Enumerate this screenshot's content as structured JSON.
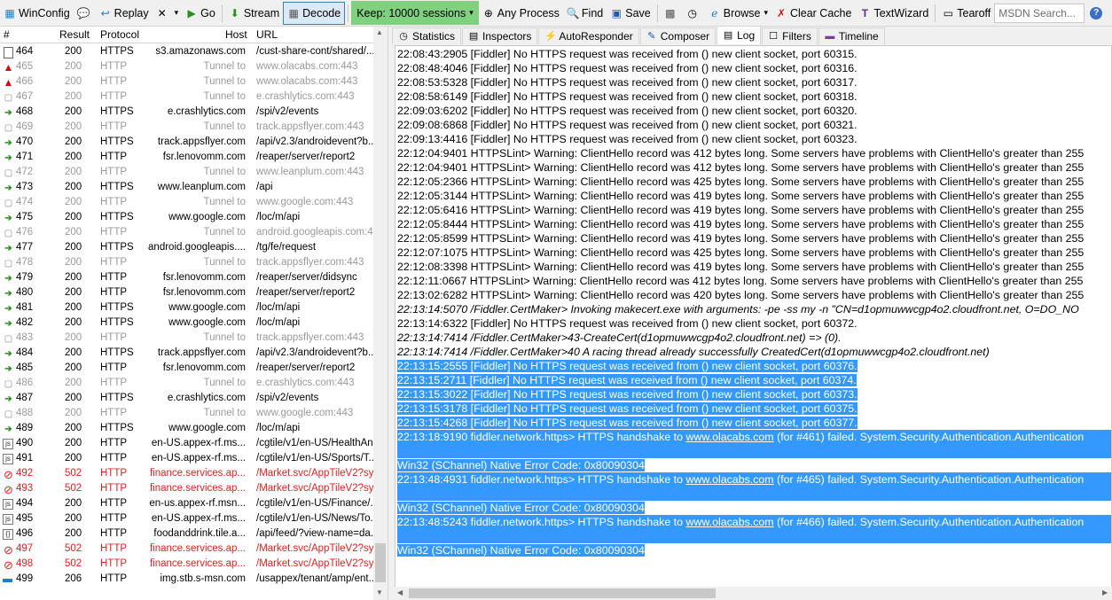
{
  "toolbar": {
    "winconfig": "WinConfig",
    "replay": "Replay",
    "go": "Go",
    "stream": "Stream",
    "decode": "Decode",
    "keep": "Keep: 10000 sessions",
    "any_process": "Any Process",
    "find": "Find",
    "save": "Save",
    "browse": "Browse",
    "clear_cache": "Clear Cache",
    "textwizard": "TextWizard",
    "tearoff": "Tearoff",
    "search_placeholder": "MSDN Search..."
  },
  "sessions": {
    "columns": {
      "num": "#",
      "result": "Result",
      "protocol": "Protocol",
      "host": "Host",
      "url": "URL"
    },
    "rows": [
      {
        "icon": "page-icon",
        "num": "464",
        "result": "200",
        "protocol": "HTTPS",
        "host": "s3.amazonaws.com",
        "url": "/cust-share-cont/shared/...",
        "kind": "normal"
      },
      {
        "icon": "warning-icon",
        "num": "465",
        "result": "200",
        "protocol": "HTTP",
        "host": "Tunnel to",
        "url": "www.olacabs.com:443",
        "kind": "tunnel"
      },
      {
        "icon": "warning-icon",
        "num": "466",
        "result": "200",
        "protocol": "HTTP",
        "host": "Tunnel to",
        "url": "www.olacabs.com:443",
        "kind": "tunnel"
      },
      {
        "icon": "lock-icon",
        "num": "467",
        "result": "200",
        "protocol": "HTTP",
        "host": "Tunnel to",
        "url": "e.crashlytics.com:443",
        "kind": "tunnel"
      },
      {
        "icon": "arrow-icon",
        "num": "468",
        "result": "200",
        "protocol": "HTTPS",
        "host": "e.crashlytics.com",
        "url": "/spi/v2/events",
        "kind": "normal"
      },
      {
        "icon": "lock-icon",
        "num": "469",
        "result": "200",
        "protocol": "HTTP",
        "host": "Tunnel to",
        "url": "track.appsflyer.com:443",
        "kind": "tunnel"
      },
      {
        "icon": "arrow-icon",
        "num": "470",
        "result": "200",
        "protocol": "HTTPS",
        "host": "track.appsflyer.com",
        "url": "/api/v2.3/androidevent?b...",
        "kind": "normal"
      },
      {
        "icon": "arrow-icon",
        "num": "471",
        "result": "200",
        "protocol": "HTTP",
        "host": "fsr.lenovomm.com",
        "url": "/reaper/server/report2",
        "kind": "normal"
      },
      {
        "icon": "lock-icon",
        "num": "472",
        "result": "200",
        "protocol": "HTTP",
        "host": "Tunnel to",
        "url": "www.leanplum.com:443",
        "kind": "tunnel"
      },
      {
        "icon": "arrow-icon",
        "num": "473",
        "result": "200",
        "protocol": "HTTPS",
        "host": "www.leanplum.com",
        "url": "/api",
        "kind": "normal"
      },
      {
        "icon": "lock-icon",
        "num": "474",
        "result": "200",
        "protocol": "HTTP",
        "host": "Tunnel to",
        "url": "www.google.com:443",
        "kind": "tunnel"
      },
      {
        "icon": "arrow-icon",
        "num": "475",
        "result": "200",
        "protocol": "HTTPS",
        "host": "www.google.com",
        "url": "/loc/m/api",
        "kind": "normal"
      },
      {
        "icon": "lock-icon",
        "num": "476",
        "result": "200",
        "protocol": "HTTP",
        "host": "Tunnel to",
        "url": "android.googleapis.com:443",
        "kind": "tunnel"
      },
      {
        "icon": "arrow-icon",
        "num": "477",
        "result": "200",
        "protocol": "HTTPS",
        "host": "android.googleapis....",
        "url": "/tg/fe/request",
        "kind": "normal"
      },
      {
        "icon": "lock-icon",
        "num": "478",
        "result": "200",
        "protocol": "HTTP",
        "host": "Tunnel to",
        "url": "track.appsflyer.com:443",
        "kind": "tunnel"
      },
      {
        "icon": "arrow-icon",
        "num": "479",
        "result": "200",
        "protocol": "HTTP",
        "host": "fsr.lenovomm.com",
        "url": "/reaper/server/didsync",
        "kind": "normal"
      },
      {
        "icon": "arrow-icon",
        "num": "480",
        "result": "200",
        "protocol": "HTTP",
        "host": "fsr.lenovomm.com",
        "url": "/reaper/server/report2",
        "kind": "normal"
      },
      {
        "icon": "arrow-icon",
        "num": "481",
        "result": "200",
        "protocol": "HTTPS",
        "host": "www.google.com",
        "url": "/loc/m/api",
        "kind": "normal"
      },
      {
        "icon": "arrow-icon",
        "num": "482",
        "result": "200",
        "protocol": "HTTPS",
        "host": "www.google.com",
        "url": "/loc/m/api",
        "kind": "normal"
      },
      {
        "icon": "lock-icon",
        "num": "483",
        "result": "200",
        "protocol": "HTTP",
        "host": "Tunnel to",
        "url": "track.appsflyer.com:443",
        "kind": "tunnel"
      },
      {
        "icon": "arrow-icon",
        "num": "484",
        "result": "200",
        "protocol": "HTTPS",
        "host": "track.appsflyer.com",
        "url": "/api/v2.3/androidevent?b...",
        "kind": "normal"
      },
      {
        "icon": "arrow-icon",
        "num": "485",
        "result": "200",
        "protocol": "HTTP",
        "host": "fsr.lenovomm.com",
        "url": "/reaper/server/report2",
        "kind": "normal"
      },
      {
        "icon": "lock-icon",
        "num": "486",
        "result": "200",
        "protocol": "HTTP",
        "host": "Tunnel to",
        "url": "e.crashlytics.com:443",
        "kind": "tunnel"
      },
      {
        "icon": "arrow-icon",
        "num": "487",
        "result": "200",
        "protocol": "HTTPS",
        "host": "e.crashlytics.com",
        "url": "/spi/v2/events",
        "kind": "normal"
      },
      {
        "icon": "lock-icon",
        "num": "488",
        "result": "200",
        "protocol": "HTTP",
        "host": "Tunnel to",
        "url": "www.google.com:443",
        "kind": "tunnel"
      },
      {
        "icon": "arrow-icon",
        "num": "489",
        "result": "200",
        "protocol": "HTTPS",
        "host": "www.google.com",
        "url": "/loc/m/api",
        "kind": "normal"
      },
      {
        "icon": "script-icon",
        "num": "490",
        "result": "200",
        "protocol": "HTTP",
        "host": "en-US.appex-rf.ms...",
        "url": "/cgtile/v1/en-US/HealthAn...",
        "kind": "normal"
      },
      {
        "icon": "script-icon",
        "num": "491",
        "result": "200",
        "protocol": "HTTP",
        "host": "en-US.appex-rf.ms...",
        "url": "/cgtile/v1/en-US/Sports/T...",
        "kind": "normal"
      },
      {
        "icon": "blocked-icon",
        "num": "492",
        "result": "502",
        "protocol": "HTTP",
        "host": "finance.services.ap...",
        "url": "/Market.svc/AppTileV2?sy...",
        "kind": "err"
      },
      {
        "icon": "blocked-icon",
        "num": "493",
        "result": "502",
        "protocol": "HTTP",
        "host": "finance.services.ap...",
        "url": "/Market.svc/AppTileV2?sy...",
        "kind": "err"
      },
      {
        "icon": "script-icon",
        "num": "494",
        "result": "200",
        "protocol": "HTTP",
        "host": "en-us.appex-rf.msn...",
        "url": "/cgtile/v1/en-US/Finance/...",
        "kind": "normal"
      },
      {
        "icon": "script-icon",
        "num": "495",
        "result": "200",
        "protocol": "HTTP",
        "host": "en-US.appex-rf.ms...",
        "url": "/cgtile/v1/en-US/News/To...",
        "kind": "normal"
      },
      {
        "icon": "json-icon",
        "num": "496",
        "result": "200",
        "protocol": "HTTP",
        "host": "foodanddrink.tile.a...",
        "url": "/api/feed/?view-name=da...",
        "kind": "normal"
      },
      {
        "icon": "blocked-icon",
        "num": "497",
        "result": "502",
        "protocol": "HTTP",
        "host": "finance.services.ap...",
        "url": "/Market.svc/AppTileV2?sy...",
        "kind": "err"
      },
      {
        "icon": "blocked-icon",
        "num": "498",
        "result": "502",
        "protocol": "HTTP",
        "host": "finance.services.ap...",
        "url": "/Market.svc/AppTileV2?sy...",
        "kind": "err"
      },
      {
        "icon": "partial-icon",
        "num": "499",
        "result": "206",
        "protocol": "HTTP",
        "host": "img.stb.s-msn.com",
        "url": "/usappex/tenant/amp/ent...",
        "kind": "normal"
      }
    ]
  },
  "tabs": [
    {
      "label": "Statistics",
      "icon": "stopwatch-icon",
      "active": false
    },
    {
      "label": "Inspectors",
      "icon": "inspector-icon",
      "active": false
    },
    {
      "label": "AutoResponder",
      "icon": "lightning-icon",
      "active": false
    },
    {
      "label": "Composer",
      "icon": "compose-icon",
      "active": false
    },
    {
      "label": "Log",
      "icon": "log-icon",
      "active": true
    },
    {
      "label": "Filters",
      "icon": "checkbox-icon",
      "active": false
    },
    {
      "label": "Timeline",
      "icon": "timeline-icon",
      "active": false
    }
  ],
  "log": [
    {
      "text": "22:08:43:2905 [Fiddler] No HTTPS request was received from () new client socket, port 60315.",
      "style": "normal"
    },
    {
      "text": "22:08:48:4046 [Fiddler] No HTTPS request was received from () new client socket, port 60316.",
      "style": "normal"
    },
    {
      "text": "22:08:53:5328 [Fiddler] No HTTPS request was received from () new client socket, port 60317.",
      "style": "normal"
    },
    {
      "text": "22:08:58:6149 [Fiddler] No HTTPS request was received from () new client socket, port 60318.",
      "style": "normal"
    },
    {
      "text": "22:09:03:6202 [Fiddler] No HTTPS request was received from () new client socket, port 60320.",
      "style": "normal"
    },
    {
      "text": "22:09:08:6868 [Fiddler] No HTTPS request was received from () new client socket, port 60321.",
      "style": "normal"
    },
    {
      "text": "22:09:13:4416 [Fiddler] No HTTPS request was received from () new client socket, port 60323.",
      "style": "normal"
    },
    {
      "text": "22:12:04:9401 HTTPSLint> Warning: ClientHello record was 412 bytes long. Some servers have problems with ClientHello's greater than 255",
      "style": "normal"
    },
    {
      "text": "22:12:04:9401 HTTPSLint> Warning: ClientHello record was 412 bytes long. Some servers have problems with ClientHello's greater than 255",
      "style": "normal"
    },
    {
      "text": "22:12:05:2366 HTTPSLint> Warning: ClientHello record was 425 bytes long. Some servers have problems with ClientHello's greater than 255",
      "style": "normal"
    },
    {
      "text": "22:12:05:3144 HTTPSLint> Warning: ClientHello record was 419 bytes long. Some servers have problems with ClientHello's greater than 255",
      "style": "normal"
    },
    {
      "text": "22:12:05:6416 HTTPSLint> Warning: ClientHello record was 419 bytes long. Some servers have problems with ClientHello's greater than 255",
      "style": "normal"
    },
    {
      "text": "22:12:05:8444 HTTPSLint> Warning: ClientHello record was 419 bytes long. Some servers have problems with ClientHello's greater than 255",
      "style": "normal"
    },
    {
      "text": "22:12:05:8599 HTTPSLint> Warning: ClientHello record was 419 bytes long. Some servers have problems with ClientHello's greater than 255",
      "style": "normal"
    },
    {
      "text": "22:12:07:1075 HTTPSLint> Warning: ClientHello record was 425 bytes long. Some servers have problems with ClientHello's greater than 255",
      "style": "normal"
    },
    {
      "text": "22:12:08:3398 HTTPSLint> Warning: ClientHello record was 419 bytes long. Some servers have problems with ClientHello's greater than 255",
      "style": "normal"
    },
    {
      "text": "22:12:11:0667 HTTPSLint> Warning: ClientHello record was 412 bytes long. Some servers have problems with ClientHello's greater than 255",
      "style": "normal"
    },
    {
      "text": "22:13:02:6282 HTTPSLint> Warning: ClientHello record was 420 bytes long. Some servers have problems with ClientHello's greater than 255",
      "style": "normal"
    },
    {
      "text": "22:13:14:5070 /Fiddler.CertMaker> Invoking makecert.exe with arguments: -pe -ss my -n \"CN=d1opmuwwcgp4o2.cloudfront.net, O=DO_NO",
      "style": "italic"
    },
    {
      "text": "22:13:14:6322 [Fiddler] No HTTPS request was received from () new client socket, port 60372.",
      "style": "normal"
    },
    {
      "text": "22:13:14:7414 /Fiddler.CertMaker>43-CreateCert(d1opmuwwcgp4o2.cloudfront.net) => (0).",
      "style": "italic"
    },
    {
      "text": "22:13:14:7414 /Fiddler.CertMaker>40 A racing thread already successfully CreatedCert(d1opmuwwcgp4o2.cloudfront.net)",
      "style": "italic"
    },
    {
      "text": "22:13:15:2555 [Fiddler] No HTTPS request was received from () new client socket, port 60376.",
      "style": "sel-short"
    },
    {
      "text": "22:13:15:2711 [Fiddler] No HTTPS request was received from () new client socket, port 60374.",
      "style": "sel-short"
    },
    {
      "text": "22:13:15:3022 [Fiddler] No HTTPS request was received from () new client socket, port 60373.",
      "style": "sel-short"
    },
    {
      "text": "22:13:15:3178 [Fiddler] No HTTPS request was received from () new client socket, port 60375.",
      "style": "sel-short"
    },
    {
      "text": "22:13:15:4268 [Fiddler] No HTTPS request was received from () new client socket, port 60377.",
      "style": "sel-short"
    },
    {
      "pre": "22:13:18:9190 fiddler.network.https> HTTPS handshake to ",
      "link": "www.olacabs.com",
      "post": " (for #461) failed. System.Security.Authentication.Authentication",
      "style": "sel"
    },
    {
      "text": "",
      "style": "blank"
    },
    {
      "text": "Win32 (SChannel) Native Error Code: 0x80090304",
      "style": "sel-short"
    },
    {
      "pre": "22:13:48:4931 fiddler.network.https> HTTPS handshake to ",
      "link": "www.olacabs.com",
      "post": " (for #465) failed. System.Security.Authentication.Authentication",
      "style": "sel"
    },
    {
      "text": "",
      "style": "blank"
    },
    {
      "text": "Win32 (SChannel) Native Error Code: 0x80090304",
      "style": "sel-short"
    },
    {
      "pre": "22:13:48:5243 fiddler.network.https> HTTPS handshake to ",
      "link": "www.olacabs.com",
      "post": " (for #466) failed. System.Security.Authentication.Authentication",
      "style": "sel"
    },
    {
      "text": "",
      "style": "blank"
    },
    {
      "text": "Win32 (SChannel) Native Error Code: 0x80090304",
      "style": "sel-short"
    }
  ],
  "colors": {
    "accent": "#3399ff",
    "keep_green": "#7fd17f",
    "error_red": "#e02020",
    "tunnel_gray": "#9a9a9a"
  }
}
